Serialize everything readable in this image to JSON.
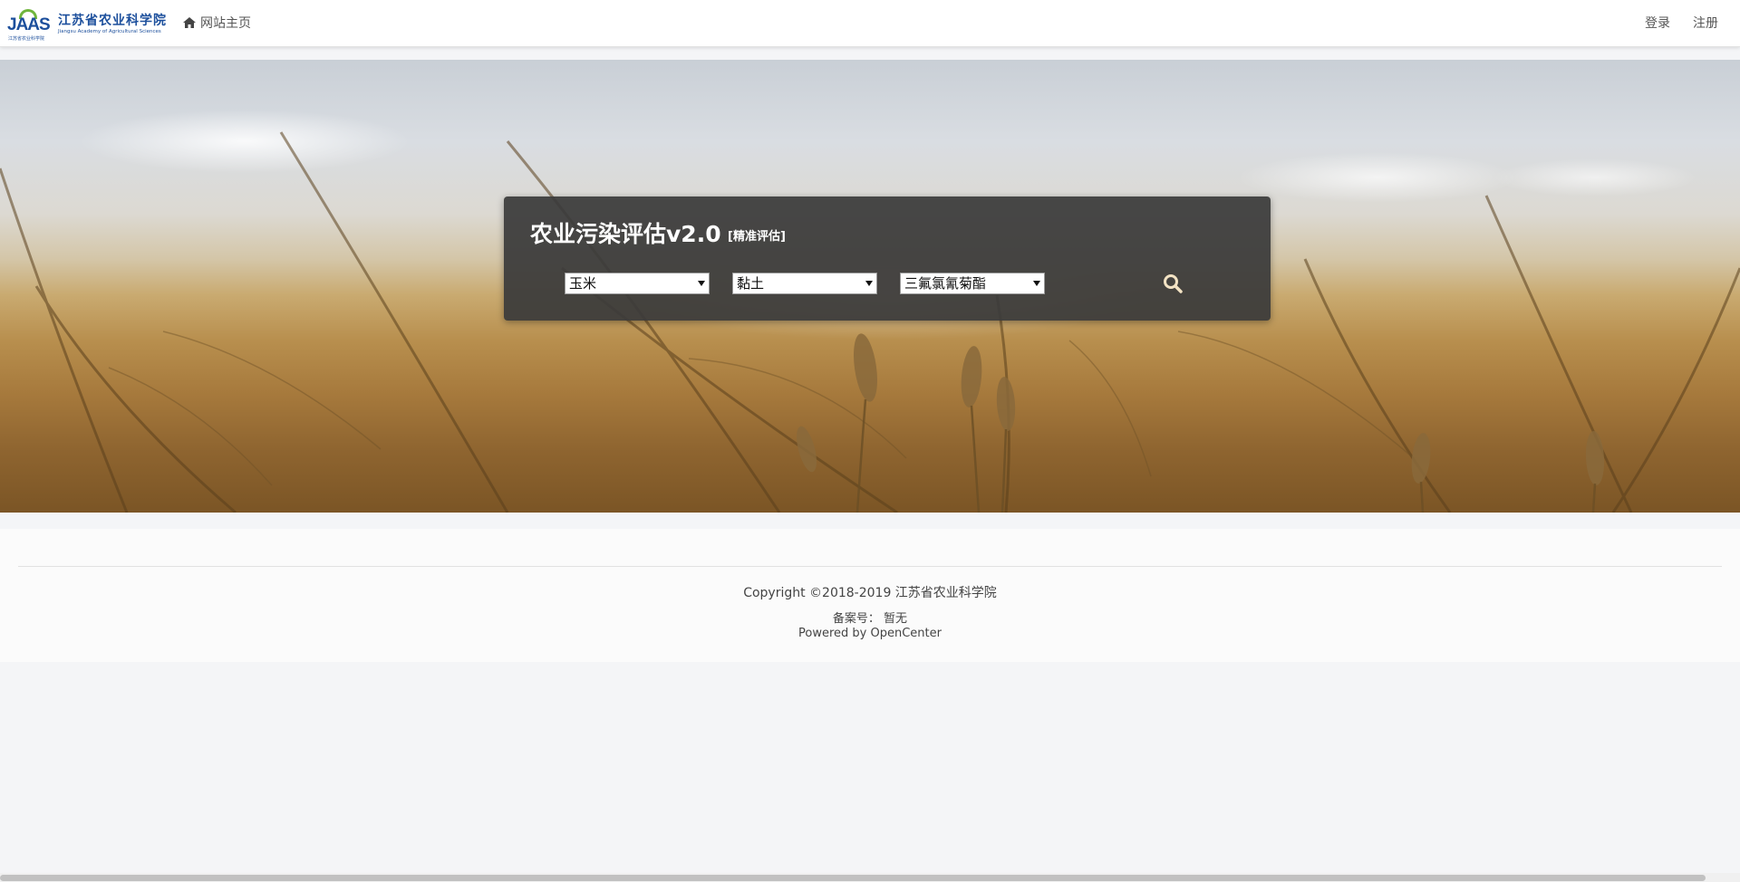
{
  "navbar": {
    "logo_letters": "JAAS",
    "logo_tiny": "江苏省农业科学院",
    "brand_cn": "江苏省农业科学院",
    "brand_en": "Jiangsu Academy of Agricultural Sciences",
    "home_label": "网站主页",
    "login_label": "登录",
    "register_label": "注册"
  },
  "panel": {
    "title": "农业污染评估v2.0",
    "subtitle": "[精准评估]",
    "selects": [
      {
        "value": "玉米"
      },
      {
        "value": "黏土"
      },
      {
        "value": "三氟氯氰菊酯"
      }
    ],
    "search_icon": "search-icon"
  },
  "footer": {
    "copyright": "Copyright ©2018-2019 江苏省农业科学院",
    "icp": "备案号： 暂无",
    "powered": "Powered by OpenCenter"
  },
  "colors": {
    "brand_blue": "#1c4f9c",
    "brand_green": "#6fb53c",
    "panel_bg": "#3a3a3a",
    "search_icon": "#f3e3c4"
  }
}
